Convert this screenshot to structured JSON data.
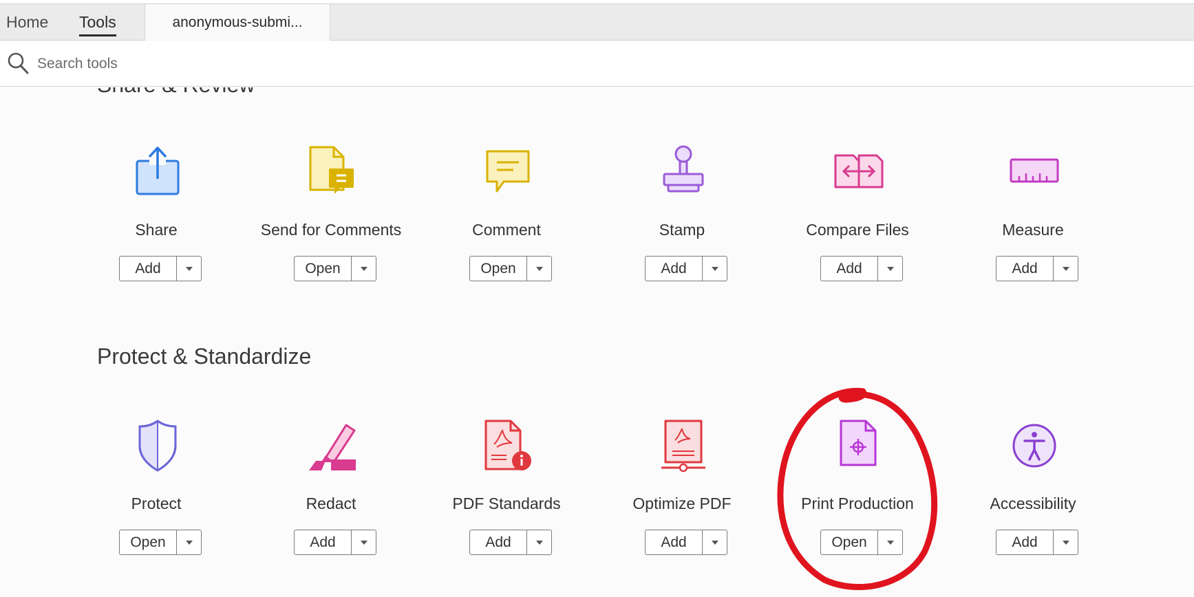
{
  "tabs": {
    "home": "Home",
    "tools": "Tools",
    "document": "anonymous-submi..."
  },
  "search": {
    "placeholder": "Search tools"
  },
  "sections": [
    {
      "title": "Share & Review",
      "tools": [
        {
          "name": "Share",
          "button": "Add",
          "icon": "share-icon",
          "color": "#2d7ae0"
        },
        {
          "name": "Send for Comments",
          "button": "Open",
          "icon": "send-for-comments-icon",
          "color": "#d9b300"
        },
        {
          "name": "Comment",
          "button": "Open",
          "icon": "comment-icon",
          "color": "#d9b300"
        },
        {
          "name": "Stamp",
          "button": "Add",
          "icon": "stamp-icon",
          "color": "#9a5bd8"
        },
        {
          "name": "Compare Files",
          "button": "Add",
          "icon": "compare-files-icon",
          "color": "#d83b8f"
        },
        {
          "name": "Measure",
          "button": "Add",
          "icon": "measure-icon",
          "color": "#c13bc1"
        }
      ]
    },
    {
      "title": "Protect & Standardize",
      "tools": [
        {
          "name": "Protect",
          "button": "Open",
          "icon": "protect-icon",
          "color": "#6b66d8"
        },
        {
          "name": "Redact",
          "button": "Add",
          "icon": "redact-icon",
          "color": "#d83b8f"
        },
        {
          "name": "PDF Standards",
          "button": "Add",
          "icon": "pdf-standards-icon",
          "color": "#e0383e"
        },
        {
          "name": "Optimize PDF",
          "button": "Add",
          "icon": "optimize-pdf-icon",
          "color": "#e0383e"
        },
        {
          "name": "Print Production",
          "button": "Open",
          "icon": "print-production-icon",
          "color": "#b737d6"
        },
        {
          "name": "Accessibility",
          "button": "Add",
          "icon": "accessibility-icon",
          "color": "#8a3fd0"
        }
      ]
    }
  ],
  "annotation": {
    "color": "#e0141e",
    "target": "Print Production"
  }
}
